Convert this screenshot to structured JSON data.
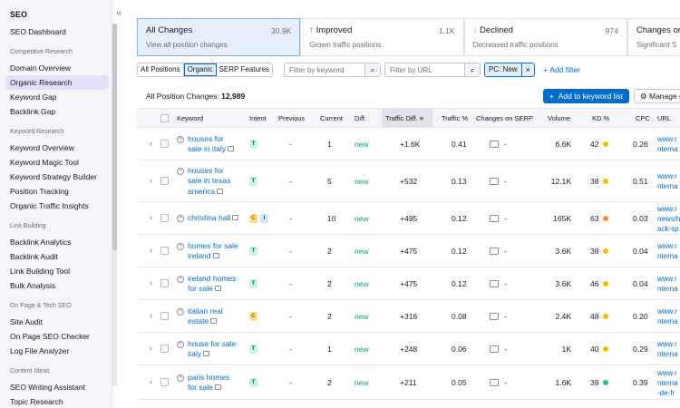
{
  "sidebar": {
    "title": "SEO",
    "dashboard": "SEO Dashboard",
    "groups": [
      {
        "label": "Competitive Research",
        "items": [
          "Domain Overview",
          "Organic Research",
          "Keyword Gap",
          "Backlink Gap"
        ]
      },
      {
        "label": "Keyword Research",
        "items": [
          "Keyword Overview",
          "Keyword Magic Tool",
          "Keyword Strategy Builder",
          "Position Tracking",
          "Organic Traffic Insights"
        ]
      },
      {
        "label": "Link Building",
        "items": [
          "Backlink Analytics",
          "Backlink Audit",
          "Link Building Tool",
          "Bulk Analysis"
        ]
      },
      {
        "label": "On Page & Tech SEO",
        "items": [
          "Site Audit",
          "On Page SEO Checker",
          "Log File Analyzer"
        ]
      },
      {
        "label": "Content Ideas",
        "items": [
          "SEO Writing Assistant",
          "Topic Research"
        ]
      }
    ],
    "active_item": "Organic Research",
    "collapse_icon": "double-chevron-left-icon"
  },
  "cards": [
    {
      "title": "All Changes",
      "value": "30.9K",
      "subtitle": "View all position changes"
    },
    {
      "title": "Improved",
      "value": "1.1K",
      "subtitle": "Grown traffic positions",
      "arrow": "↑"
    },
    {
      "title": "Declined",
      "value": "974",
      "subtitle": "Decreased traffic positions",
      "arrow": "↓"
    },
    {
      "title": "Changes on",
      "subtitle": "Significant S"
    }
  ],
  "filters": {
    "segment": [
      "All Positions",
      "Organic",
      "SERP Features"
    ],
    "keyword_placeholder": "Filter by keyword",
    "url_placeholder": "Filter by URL",
    "chip": "PC: New",
    "add_filter": "Add filter"
  },
  "table": {
    "count_label": "All Position Changes: ",
    "count_value": "12,989",
    "add_to_list": "Add to keyword list",
    "manage": "Manage c",
    "headers": [
      "Keyword",
      "Intent",
      "Previous",
      "Current",
      "Diff.",
      "Traffic Diff.",
      "Traffic %",
      "Changes on SERP",
      "Volume",
      "KD %",
      "CPC",
      "URL"
    ],
    "rows": [
      {
        "keyword": [
          "houses for",
          "sale in italy"
        ],
        "intent": [
          "T"
        ],
        "previous": "-",
        "current": "1",
        "diff": "new",
        "traffic_diff": "+1.6K",
        "traffic_pct": "0.41",
        "serp": "-",
        "volume": "6.6K",
        "kd": "42",
        "kd_color": "#f5c000",
        "cpc": "0.26",
        "url": [
          "www.r",
          "nterna"
        ]
      },
      {
        "keyword": [
          "houses for",
          "sale in texas",
          "america"
        ],
        "intent": [
          "T"
        ],
        "previous": "-",
        "current": "5",
        "diff": "new",
        "traffic_diff": "+532",
        "traffic_pct": "0.13",
        "serp": "-",
        "volume": "12.1K",
        "kd": "38",
        "kd_color": "#f5c000",
        "cpc": "0.51",
        "url": [
          "www.r",
          "nterna"
        ]
      },
      {
        "keyword": [
          "christina hall"
        ],
        "intent": [
          "C",
          "I"
        ],
        "previous": "-",
        "current": "10",
        "diff": "new",
        "traffic_diff": "+495",
        "traffic_pct": "0.12",
        "serp": "-",
        "volume": "165K",
        "kd": "63",
        "kd_color": "#ff8c2b",
        "cpc": "0.03",
        "url": [
          "www.r",
          "news/h",
          "ack-sp"
        ]
      },
      {
        "keyword": [
          "homes for sale",
          "ireland"
        ],
        "intent": [
          "T"
        ],
        "previous": "-",
        "current": "2",
        "diff": "new",
        "traffic_diff": "+475",
        "traffic_pct": "0.12",
        "serp": "-",
        "volume": "3.6K",
        "kd": "38",
        "kd_color": "#f5c000",
        "cpc": "0.04",
        "url": [
          "www.r",
          "nterna"
        ]
      },
      {
        "keyword": [
          "ireland homes",
          "for sale"
        ],
        "intent": [
          "T"
        ],
        "previous": "-",
        "current": "2",
        "diff": "new",
        "traffic_diff": "+475",
        "traffic_pct": "0.12",
        "serp": "-",
        "volume": "3.6K",
        "kd": "46",
        "kd_color": "#f5c000",
        "cpc": "0.04",
        "url": [
          "www.r",
          "nterna"
        ]
      },
      {
        "keyword": [
          "italian real",
          "estate"
        ],
        "intent": [
          "C"
        ],
        "previous": "-",
        "current": "2",
        "diff": "new",
        "traffic_diff": "+316",
        "traffic_pct": "0.08",
        "serp": "-",
        "volume": "2.4K",
        "kd": "48",
        "kd_color": "#f5c000",
        "cpc": "0.20",
        "url": [
          "www.r",
          "nterna"
        ]
      },
      {
        "keyword": [
          "house for sale",
          "italy"
        ],
        "intent": [
          "T"
        ],
        "previous": "-",
        "current": "1",
        "diff": "new",
        "traffic_diff": "+248",
        "traffic_pct": "0.06",
        "serp": "-",
        "volume": "1K",
        "kd": "40",
        "kd_color": "#f5c000",
        "cpc": "0.29",
        "url": [
          "www.r",
          "nterna"
        ]
      },
      {
        "keyword": [
          "paris homes",
          "for sale"
        ],
        "intent": [
          "T"
        ],
        "previous": "-",
        "current": "2",
        "diff": "new",
        "traffic_diff": "+211",
        "traffic_pct": "0.05",
        "serp": "-",
        "volume": "1.6K",
        "kd": "39",
        "kd_color": "#2bc28a",
        "cpc": "0.39",
        "url": [
          "www.r",
          "nterna",
          "-de-fr"
        ]
      }
    ]
  }
}
